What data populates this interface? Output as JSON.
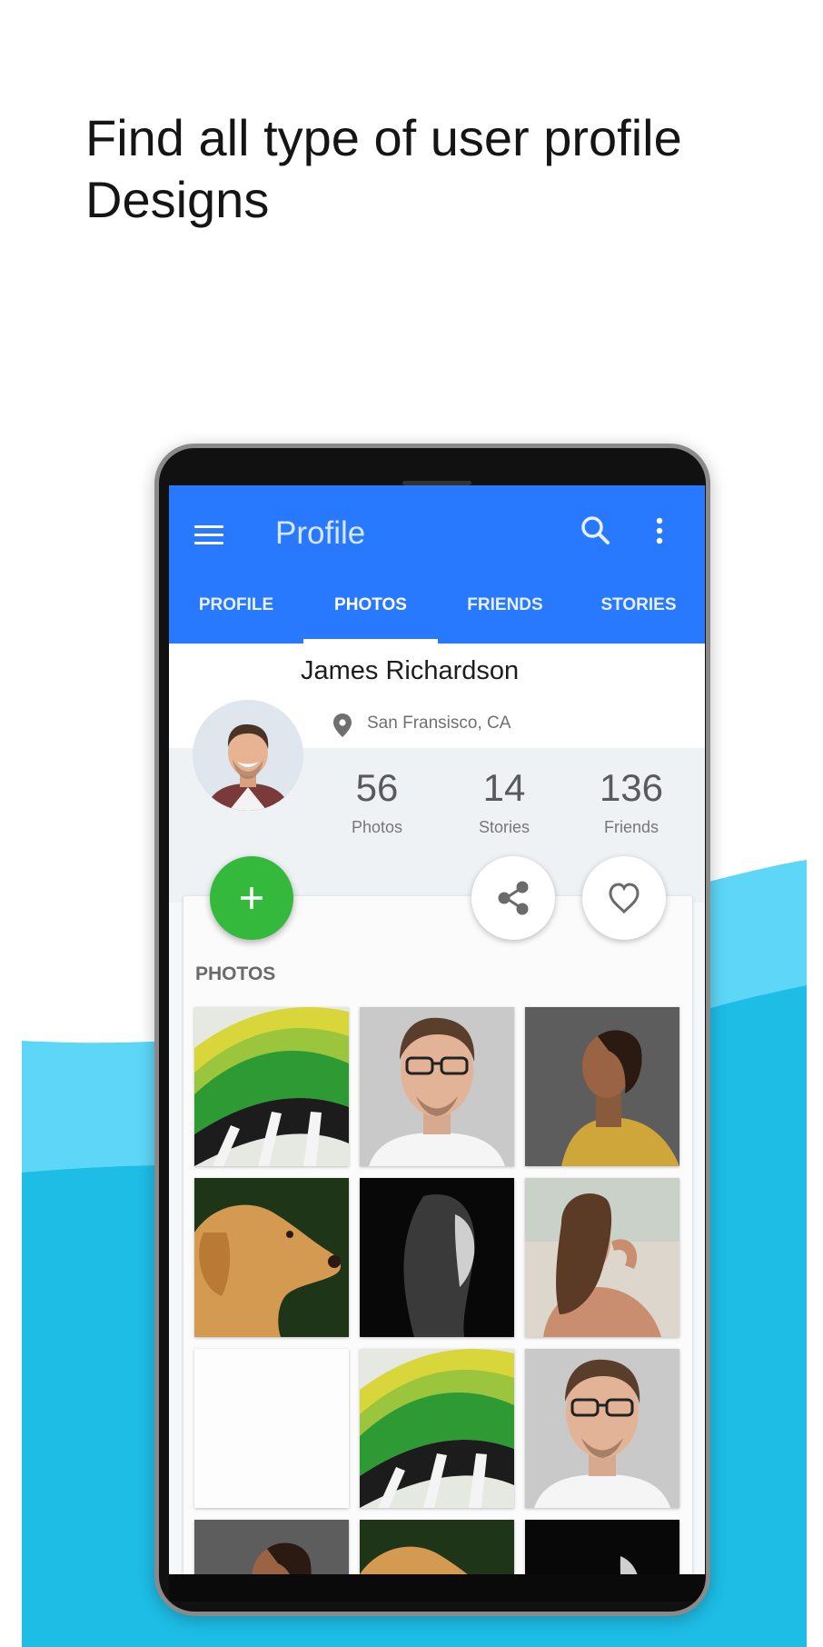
{
  "headline": {
    "line1": "Find all type of user profile",
    "line2": "Designs"
  },
  "colors": {
    "appbar": "#2979ff",
    "fab": "#34b93c",
    "wave_light": "#5dd6f7",
    "wave_dark": "#1dbde6"
  },
  "appbar": {
    "title": "Profile",
    "icons": [
      "menu-icon",
      "search-icon",
      "more-vert-icon"
    ],
    "tabs": [
      {
        "label": "PROFILE"
      },
      {
        "label": "PHOTOS"
      },
      {
        "label": "FRIENDS"
      },
      {
        "label": "STORIES"
      }
    ],
    "active_tab": "PHOTOS"
  },
  "profile": {
    "name": "James Richardson",
    "location": "San Fransisco, CA",
    "stats": [
      {
        "value": "56",
        "label": "Photos"
      },
      {
        "value": "14",
        "label": "Stories"
      },
      {
        "value": "136",
        "label": "Friends"
      }
    ]
  },
  "actions": {
    "fab_icon": "plus-icon",
    "share_icon": "share-icon",
    "favorite_icon": "heart-icon"
  },
  "photos": {
    "title": "PHOTOS",
    "items": [
      "color-swatches",
      "man-glasses",
      "woman-profile",
      "dog",
      "woman-dark",
      "woman-beach",
      "blank",
      "color-swatches",
      "man-glasses",
      "woman-profile",
      "dog",
      "woman-dark"
    ]
  }
}
